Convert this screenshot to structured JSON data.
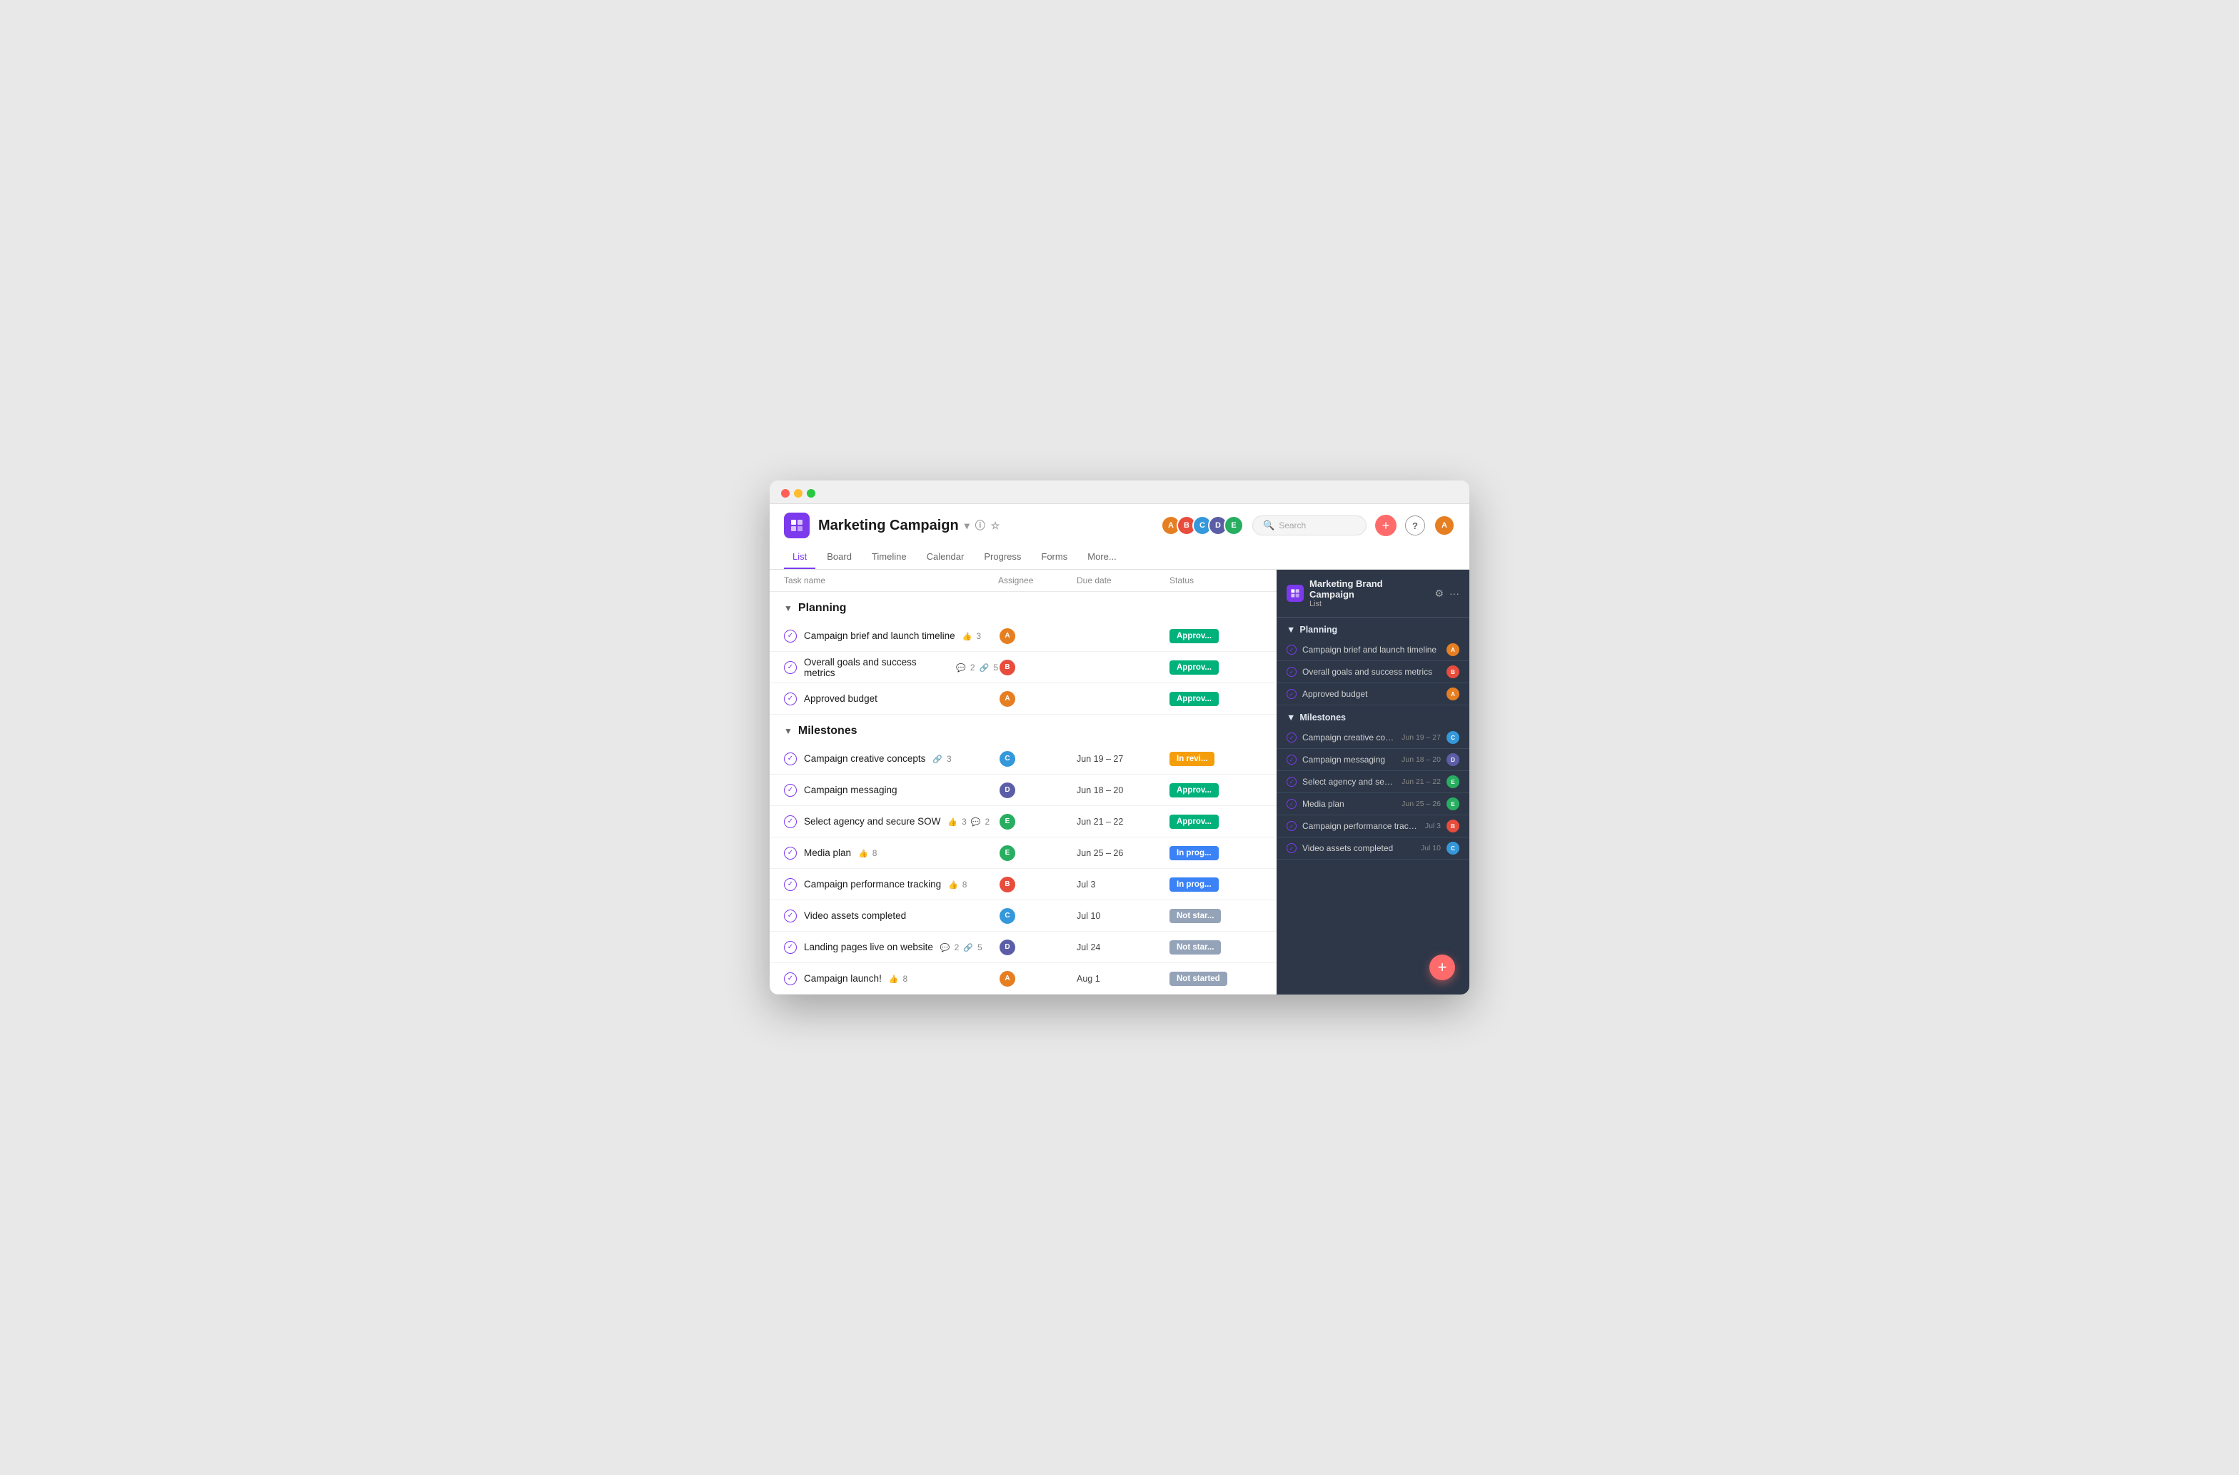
{
  "window": {
    "title": "Marketing Campaign"
  },
  "header": {
    "project_name": "Marketing Campaign",
    "nav_tabs": [
      "List",
      "Board",
      "Timeline",
      "Calendar",
      "Progress",
      "Forms",
      "More..."
    ],
    "active_tab": "List",
    "search_placeholder": "Search",
    "add_label": "+",
    "help_label": "?"
  },
  "table": {
    "columns": [
      "Task name",
      "Assignee",
      "Due date",
      "Status"
    ],
    "sections": [
      {
        "name": "Planning",
        "tasks": [
          {
            "name": "Campaign brief and launch timeline",
            "meta": {
              "thumbs": 3
            },
            "assignee_color": "#e67e22",
            "due": "",
            "status": "Approved",
            "status_class": "status-approved"
          },
          {
            "name": "Overall goals and success metrics",
            "meta": {
              "comments": 2,
              "links": 5
            },
            "assignee_color": "#e74c3c",
            "due": "",
            "status": "Approved",
            "status_class": "status-approved"
          },
          {
            "name": "Approved budget",
            "meta": {},
            "assignee_color": "#e67e22",
            "due": "",
            "status": "Approved",
            "status_class": "status-approved"
          }
        ]
      },
      {
        "name": "Milestones",
        "tasks": [
          {
            "name": "Campaign creative concepts",
            "meta": {
              "links": 3
            },
            "assignee_color": "#3498db",
            "due": "Jun 19 – 27",
            "status": "In review",
            "status_class": "status-in-review"
          },
          {
            "name": "Campaign messaging",
            "meta": {},
            "assignee_color": "#5b5ea6",
            "due": "Jun 18 – 20",
            "status": "Approved",
            "status_class": "status-approved"
          },
          {
            "name": "Select agency and secure SOW",
            "meta": {
              "thumbs": 3,
              "comments": 2
            },
            "assignee_color": "#27ae60",
            "due": "Jun 21 – 22",
            "status": "Approved",
            "status_class": "status-approved"
          },
          {
            "name": "Media plan",
            "meta": {
              "thumbs": 8
            },
            "assignee_color": "#27ae60",
            "due": "Jun 25 – 26",
            "status": "In progress",
            "status_class": "status-in-progress"
          },
          {
            "name": "Campaign performance tracking",
            "meta": {
              "thumbs": 8
            },
            "assignee_color": "#e74c3c",
            "due": "Jul 3",
            "status": "In progress",
            "status_class": "status-in-progress"
          },
          {
            "name": "Video assets completed",
            "meta": {},
            "assignee_color": "#3498db",
            "due": "Jul 10",
            "status": "Not started",
            "status_class": "status-not-started"
          },
          {
            "name": "Landing pages live on website",
            "meta": {
              "comments": 2,
              "links": 5
            },
            "assignee_color": "#5b5ea6",
            "due": "Jul 24",
            "status": "Not started",
            "status_class": "status-not-started"
          },
          {
            "name": "Campaign launch!",
            "meta": {
              "thumbs": 8
            },
            "assignee_color": "#e67e22",
            "due": "Aug 1",
            "status": "Not started",
            "status_class": "status-not-started"
          }
        ]
      }
    ]
  },
  "side_panel": {
    "title": "Marketing Brand Campaign",
    "subtitle": "List",
    "sections": [
      {
        "name": "Planning",
        "tasks": [
          {
            "name": "Campaign brief and launch timeline",
            "date": "",
            "avatar_color": "#e67e22"
          },
          {
            "name": "Overall goals and success metrics",
            "date": "",
            "avatar_color": "#e74c3c"
          },
          {
            "name": "Approved budget",
            "date": "",
            "avatar_color": "#e67e22"
          }
        ]
      },
      {
        "name": "Milestones",
        "tasks": [
          {
            "name": "Campaign creative conc...",
            "date": "Jun 19 – 27",
            "avatar_color": "#3498db"
          },
          {
            "name": "Campaign messaging",
            "date": "Jun 18 – 20",
            "avatar_color": "#5b5ea6"
          },
          {
            "name": "Select agency and secu...",
            "date": "Jun 21 – 22",
            "avatar_color": "#27ae60"
          },
          {
            "name": "Media plan",
            "date": "Jun 25 – 26",
            "avatar_color": "#27ae60"
          },
          {
            "name": "Campaign performance track...",
            "date": "Jul 3",
            "avatar_color": "#e74c3c"
          },
          {
            "name": "Video assets completed",
            "date": "Jul 10",
            "avatar_color": "#3498db"
          }
        ]
      }
    ]
  },
  "avatars": [
    {
      "color": "#e67e22",
      "initials": "A"
    },
    {
      "color": "#e74c3c",
      "initials": "B"
    },
    {
      "color": "#3498db",
      "initials": "C"
    },
    {
      "color": "#5b5ea6",
      "initials": "D"
    },
    {
      "color": "#27ae60",
      "initials": "E"
    }
  ]
}
